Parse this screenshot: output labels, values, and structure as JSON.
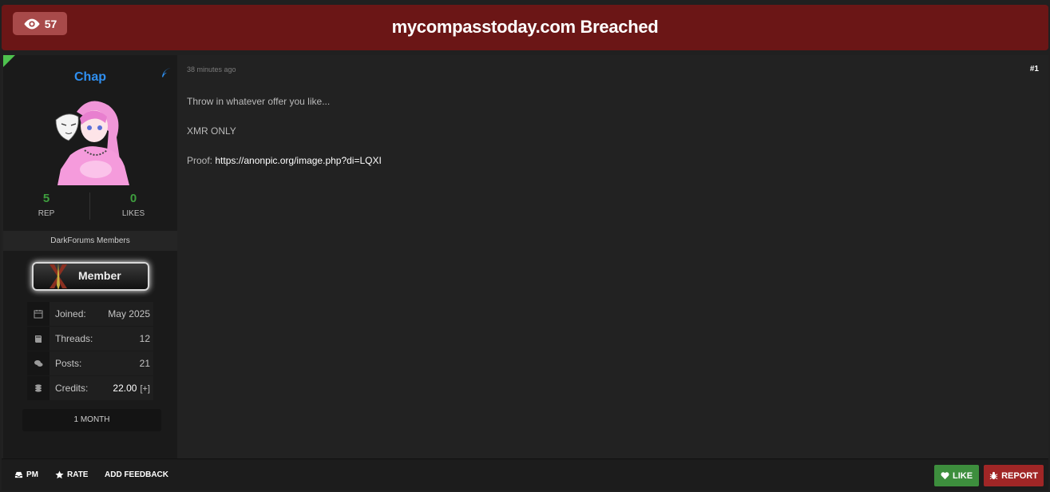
{
  "thread": {
    "title": "mycompasstoday.com Breached",
    "views": "57"
  },
  "user": {
    "name": "Chap",
    "rep_value": "5",
    "rep_label": "REP",
    "likes_value": "0",
    "likes_label": "LIKES",
    "group": "DarkForums Members",
    "rank": "Member",
    "stats": [
      {
        "key": "Joined:",
        "value": "May 2025",
        "icon": "calendar-icon"
      },
      {
        "key": "Threads:",
        "value": "12",
        "icon": "book-icon"
      },
      {
        "key": "Posts:",
        "value": "21",
        "icon": "comments-icon"
      },
      {
        "key": "Credits:",
        "value": "22.00",
        "extra": "[+]",
        "icon": "coins-icon"
      }
    ],
    "membership": "1 MONTH"
  },
  "post": {
    "time": "38 minutes ago",
    "number": "#1",
    "line1": "Throw in whatever offer you like...",
    "line2": "XMR ONLY",
    "proof_label": "Proof: ",
    "proof_link": "https://anonpic.org/image.php?di=LQXI"
  },
  "actions": {
    "pm": "PM",
    "rate": "RATE",
    "feedback": "ADD FEEDBACK",
    "like": "LIKE",
    "report": "REPORT"
  },
  "colors": {
    "header": "#6b1616",
    "username": "#2f8ff0",
    "like": "#3d8e3d",
    "report": "#a02626"
  }
}
